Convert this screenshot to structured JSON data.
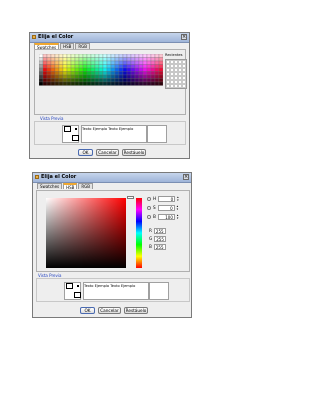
{
  "dialog": {
    "title": "Elija el Color",
    "tabs": [
      "Swatches",
      "HSB",
      "RGB"
    ],
    "preview_label": "Vista Previa",
    "sample_text": "Texto Ejemplo  Texto Ejemplo",
    "buttons": {
      "ok": "OK",
      "cancel": "Cancelar",
      "reset": "Restáuelo"
    }
  },
  "swatches_panel": {
    "recent_label": "Recientes"
  },
  "hsb_panel": {
    "fields": [
      {
        "label": "H",
        "value": "0"
      },
      {
        "label": "S",
        "value": "0"
      },
      {
        "label": "B",
        "value": "100"
      }
    ],
    "rgb": [
      {
        "label": "R",
        "value": "255"
      },
      {
        "label": "G",
        "value": "255"
      },
      {
        "label": "B",
        "value": "255"
      }
    ]
  }
}
